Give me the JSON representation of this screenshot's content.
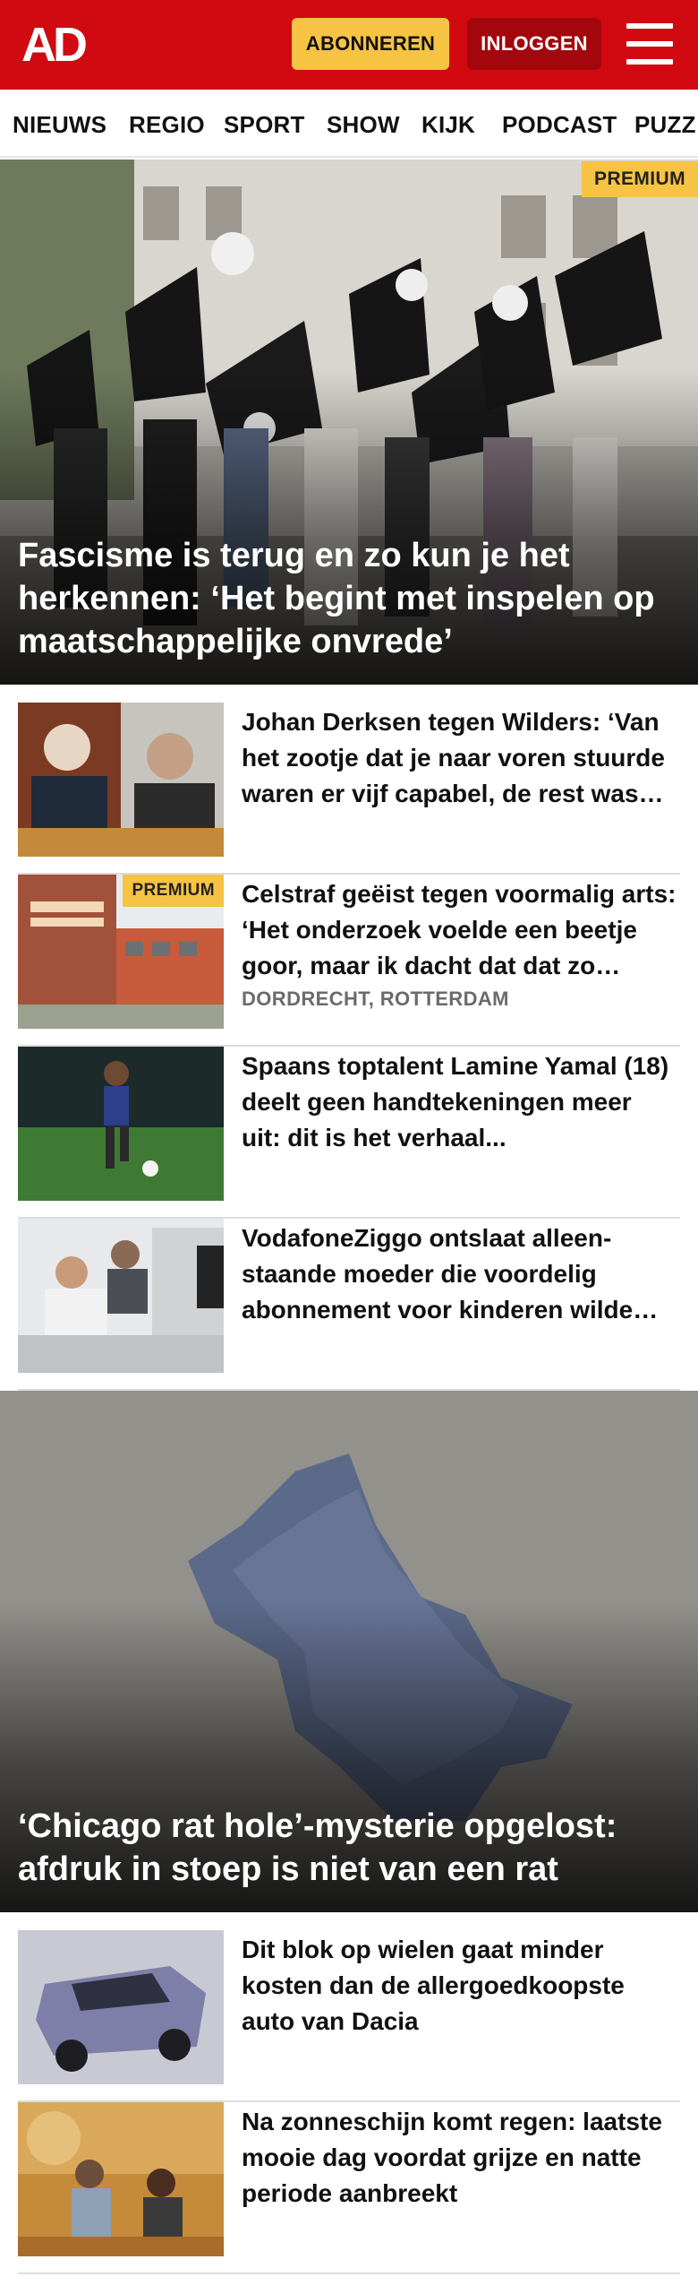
{
  "header": {
    "logo": "AD",
    "subscribe_label": "ABONNEREN",
    "login_label": "INLOGGEN",
    "menu_icon": "hamburger-menu-icon",
    "brand_color": "#d10a11",
    "subscribe_color": "#f6c343",
    "login_color": "#a3070d"
  },
  "nav": {
    "items": [
      "NIEUWS",
      "REGIO",
      "SPORT",
      "SHOW",
      "KIJK",
      "PODCAST",
      "PUZZ"
    ]
  },
  "hero1": {
    "badge": "PREMIUM",
    "title": "Fascisme is terug en zo kun je het herkennen: ‘Het begint met inspelen op maatschappelijke onvrede’"
  },
  "articles_a": [
    {
      "title": "Johan Derksen tegen Wilders: ‘Van het zootje dat je naar voren stuurde waren er vijf capabel, de rest was tuig’",
      "subtitle": "",
      "premium": ""
    },
    {
      "title": "Celstraf geëist tegen voormalig arts: ‘Het onderzoek voelde een beetje goor, maar ik dacht dat dat zo hoorde’",
      "subtitle": "DORDRECHT, ROTTERDAM",
      "premium": "PREMIUM"
    },
    {
      "title": "Spaans toptalent Lamine Yamal (18) deelt geen handtekeningen meer uit: dit is het verhaal...",
      "subtitle": "",
      "premium": ""
    },
    {
      "title": "VodafoneZiggo ontslaat alleen­staande moeder die voordelig abonnement voor kinderen wilde regelen",
      "subtitle": "",
      "premium": ""
    }
  ],
  "hero2": {
    "title": "‘Chicago rat hole’-mysterie opgelost: afdruk in stoep is niet van een rat"
  },
  "articles_b": [
    {
      "title": "Dit blok op wielen gaat minder kosten dan de allergoedkoopste auto van Dacia"
    },
    {
      "title": "Na zonneschijn komt regen: laatste mooie dag voordat grijze en natte periode aanbreekt"
    }
  ]
}
